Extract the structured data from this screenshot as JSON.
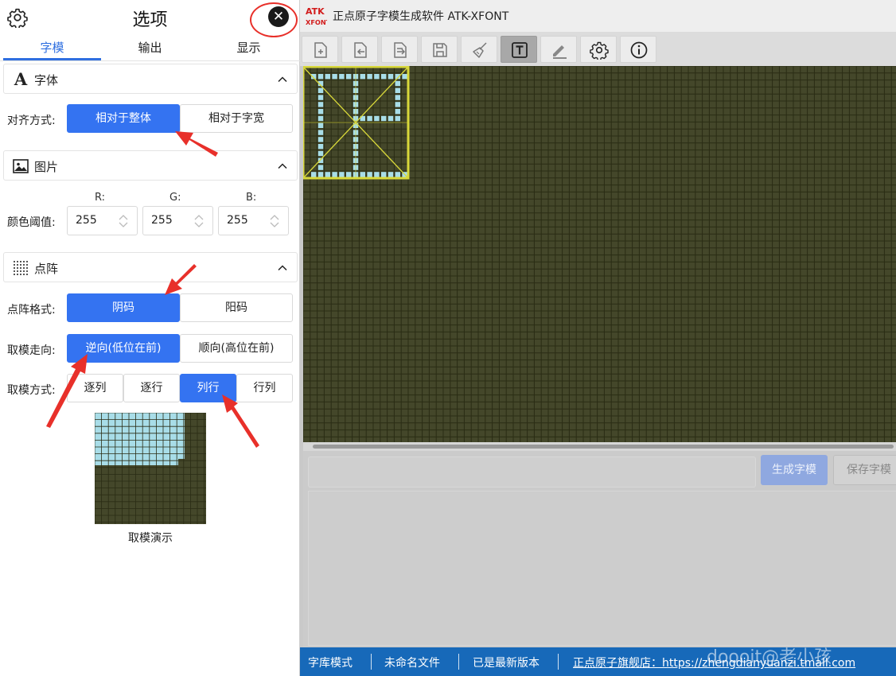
{
  "panel": {
    "title": "选项",
    "close_label": "✕",
    "tabs": [
      "字模",
      "输出",
      "显示"
    ],
    "active_tab": "字模",
    "font_section": {
      "icon_glyph": "A",
      "title": "字体",
      "align_label": "对齐方式:",
      "align_options": [
        "相对于整体",
        "相对于字宽"
      ],
      "align_selected": "相对于整体"
    },
    "image_section": {
      "title": "图片",
      "threshold_label": "颜色阈值:",
      "channels": [
        {
          "label": "R:",
          "value": "255"
        },
        {
          "label": "G:",
          "value": "255"
        },
        {
          "label": "B:",
          "value": "255"
        }
      ]
    },
    "matrix_section": {
      "title": "点阵",
      "format_label": "点阵格式:",
      "format_options": [
        "阴码",
        "阳码"
      ],
      "format_selected": "阴码",
      "direction_label": "取模走向:",
      "direction_options": [
        "逆向(低位在前)",
        "顺向(高位在前)"
      ],
      "direction_selected": "逆向(低位在前)",
      "mode_label": "取模方式:",
      "mode_options": [
        "逐列",
        "逐行",
        "列行",
        "行列"
      ],
      "mode_selected": "列行",
      "demo_caption": "取模演示"
    }
  },
  "app": {
    "logo_line1": "ATK",
    "logo_line2": "XFONT",
    "title": "正点原子字模生成软件 ATK-XFONT",
    "toolbar_icons": [
      "new-file-icon",
      "import-icon",
      "export-icon",
      "save-icon",
      "brush-icon",
      "text-icon",
      "pen-icon",
      "settings-icon",
      "info-icon"
    ],
    "toolbar_active": "text-icon",
    "generate_label": "生成字模",
    "save_label": "保存字模",
    "status": {
      "mode": "字库模式",
      "file": "未命名文件",
      "version": "已是最新版本",
      "shop": "正点原子旗舰店：https://zhengdianyuanzi.tmall.com"
    },
    "watermark": "doooit@老小孩"
  },
  "colors": {
    "accent": "#3473f1",
    "grid_bg": "#44472a",
    "grid_line": "#2a2c14",
    "pixel_on": "#a8dde8",
    "selection": "#d8d83a",
    "status_bar": "#1769b9",
    "annotation": "#e8302a"
  }
}
